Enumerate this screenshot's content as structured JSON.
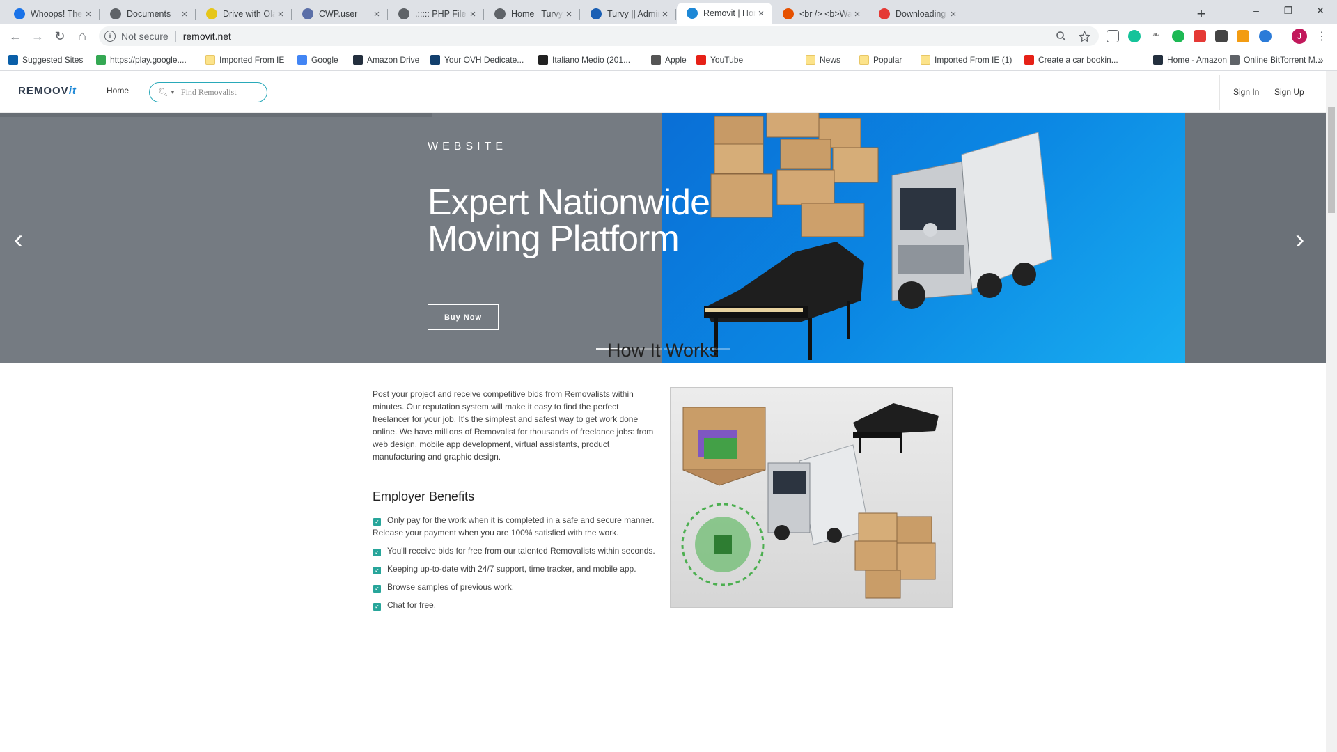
{
  "browser": {
    "tabs": [
      {
        "title": "Whoops! There was",
        "favicon_color": "#1a73e8",
        "active": false
      },
      {
        "title": "Documents",
        "favicon_color": "#5f6368",
        "active": false
      },
      {
        "title": "Drive with Ola Austr",
        "favicon_color": "#e6c619",
        "active": false
      },
      {
        "title": "CWP.user",
        "favicon_color": "#5b6fa8",
        "active": false
      },
      {
        "title": ".::::: PHP File Manag",
        "favicon_color": "#5f6368",
        "active": false
      },
      {
        "title": "Home | Turvy",
        "favicon_color": "#5f6368",
        "active": false
      },
      {
        "title": "Turvy || Admin Pane",
        "favicon_color": "#1a5fb4",
        "active": false
      },
      {
        "title": "Removit | Home",
        "favicon_color": "#1e88d6",
        "active": true
      },
      {
        "title": "<br /> <b>Warning",
        "favicon_color": "#e65100",
        "active": false
      },
      {
        "title": "Downloading the M",
        "favicon_color": "#e53935",
        "active": false
      }
    ],
    "new_tab": "+",
    "window": {
      "minimize": "–",
      "restore": "❐",
      "close": "✕"
    },
    "toolbar": {
      "back": "←",
      "forward": "→",
      "reload": "↻",
      "home": "⌂"
    },
    "address": {
      "security": "Not secure",
      "url": "removit.net"
    },
    "profile_initial": "J",
    "bookmarks": [
      {
        "label": "Suggested Sites",
        "icon": "bing-icon",
        "color": "#0a5fa8"
      },
      {
        "label": "https://play.google....",
        "icon": "play-icon",
        "color": "#34a853"
      },
      {
        "label": "Imported From IE",
        "icon": "folder-icon",
        "color": "#fce38a"
      },
      {
        "label": "Google",
        "icon": "google-icon",
        "color": "#4285f4"
      },
      {
        "label": "Amazon Drive",
        "icon": "amazon-icon",
        "color": "#232f3e"
      },
      {
        "label": "Your OVH Dedicate...",
        "icon": "ovh-icon",
        "color": "#123f6d"
      },
      {
        "label": "Italiano Medio (201...",
        "icon": "film-icon",
        "color": "#222222"
      },
      {
        "label": "Apple",
        "icon": "apple-icon",
        "color": "#555555"
      },
      {
        "label": "YouTube",
        "icon": "youtube-icon",
        "color": "#e62117"
      },
      {
        "label": "News",
        "icon": "folder-icon",
        "color": "#fce38a"
      },
      {
        "label": "Popular",
        "icon": "folder-icon",
        "color": "#fce38a"
      },
      {
        "label": "Imported From IE (1)",
        "icon": "folder-icon",
        "color": "#fce38a"
      },
      {
        "label": "Create a car bookin...",
        "icon": "youtube-icon",
        "color": "#e62117"
      },
      {
        "label": "Home - Amazon",
        "icon": "amazon-icon",
        "color": "#232f3e"
      },
      {
        "label": "Online BitTorrent M...",
        "icon": "globe-icon",
        "color": "#5f6368"
      }
    ],
    "bookmarks_more": "»"
  },
  "site": {
    "logo_main": "REMOOV",
    "logo_accent": "it",
    "nav_home": "Home",
    "search_placeholder": "Find Removalist",
    "sign_in": "Sign In",
    "sign_up": "Sign Up",
    "hero": {
      "eyebrow": "WEBSITE",
      "title_line1": "Expert Nationwide",
      "title_line2": "Moving Platform",
      "button": "Buy Now",
      "slides": 4,
      "active_slide": 1,
      "prev": "‹",
      "next": "›"
    },
    "how_it_works": {
      "title": "How It Works",
      "text": "Post your project and receive competitive bids from Removalists within minutes. Our reputation system will make it easy to find the perfect freelancer for your job. It's the simplest and safest way to get work done online. We have millions of Removalist for thousands of freelance jobs: from web design, mobile app development, virtual assistants, product manufacturing and graphic design.",
      "benefits_title": "Employer Benefits",
      "benefits": [
        "Only pay for the work when it is completed in a safe and secure manner. Release your payment when you are 100% satisfied with the work.",
        "You'll receive bids for free from our talented Removalists within seconds.",
        "Keeping up-to-date with 24/7 support, time tracker, and mobile app.",
        "Browse samples of previous work.",
        "Chat for free."
      ]
    },
    "colors": {
      "accent": "#29a9b9",
      "check": "#27a59a",
      "hero_bg": "#757b82",
      "hero_blue": "#0b87e3"
    }
  }
}
